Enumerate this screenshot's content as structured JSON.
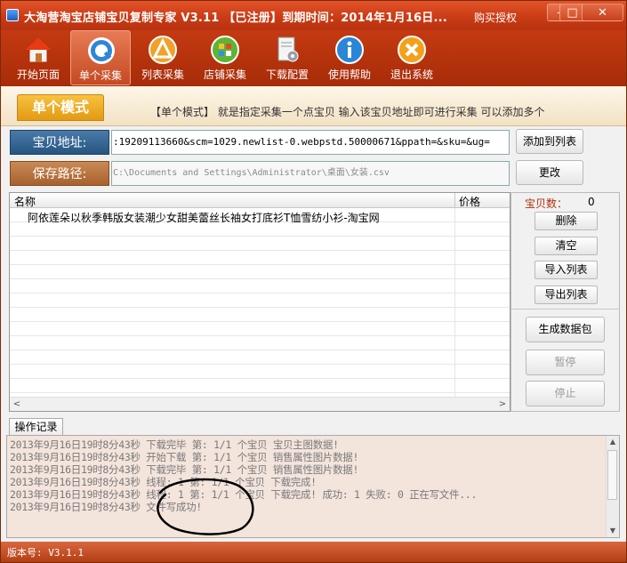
{
  "window": {
    "title": "大淘营淘宝店铺宝贝复制专家 V3.11 【已注册】到期时间：2014年1月16日...",
    "buy_link": "购买授权",
    "min_glyph": "–",
    "max_glyph": "□",
    "close_glyph": "✕"
  },
  "toolbar": {
    "items": [
      {
        "label": "开始页面",
        "icon": "home-icon"
      },
      {
        "label": "单个采集",
        "icon": "search-icon"
      },
      {
        "label": "列表采集",
        "icon": "list-icon"
      },
      {
        "label": "店铺采集",
        "icon": "shop-icon"
      },
      {
        "label": "下载配置",
        "icon": "gear-icon"
      },
      {
        "label": "使用帮助",
        "icon": "info-icon"
      },
      {
        "label": "退出系统",
        "icon": "exit-icon"
      }
    ]
  },
  "mode": {
    "tab_label": "单个模式",
    "description": "【单个模式】 就是指定采集一个点宝贝 输入该宝贝地址即可进行采集 可以添加多个"
  },
  "url_field": {
    "label": "宝贝地址:",
    "value": ":19209113660&scm=1029.newlist-0.webpstd.50000671&ppath=&sku=&ug="
  },
  "add_button": "添加到列表",
  "save_field": {
    "label": "保存路径:",
    "value": "C:\\Documents and Settings\\Administrator\\桌面\\女装.csv"
  },
  "change_button": "更改",
  "list": {
    "col_name": "名称",
    "col_price": "价格",
    "rows": [
      {
        "name": "阿依莲朵以秋季韩版女装潮少女甜美蕾丝长袖女打底衫T恤雪纺小衫-淘宝网",
        "price": ""
      }
    ],
    "scroll_left": "<",
    "scroll_right": ">"
  },
  "side": {
    "count_label": "宝贝数：",
    "count_value": "0",
    "delete": "删除",
    "clear": "清空",
    "import": "导入列表",
    "export": "导出列表",
    "generate": "生成数据包",
    "pause": "暂停",
    "stop": "停止"
  },
  "log": {
    "tab": "操作记录",
    "lines": [
      "2013年9月16日19时8分43秒  下载完毕 第: 1/1  个宝贝  宝贝主图数据!",
      "2013年9月16日19时8分43秒  开始下载 第: 1/1  个宝贝  销售属性图片数据!",
      "2013年9月16日19时8分43秒  下载完毕 第: 1/1  个宝贝  销售属性图片数据!",
      "2013年9月16日19时8分43秒  线程: 1 第: 1/1 个宝贝 下载完成!",
      "2013年9月16日19时8分43秒  线程: 1 第: 1/1 个宝贝 下载完成! 成功: 1 失败: 0 正在写文件...",
      "2013年9月16日19时8分43秒  文件写成功!"
    ],
    "scroll_up": "▲",
    "scroll_down": "▼"
  },
  "status": {
    "version": "版本号: V3.1.1"
  }
}
